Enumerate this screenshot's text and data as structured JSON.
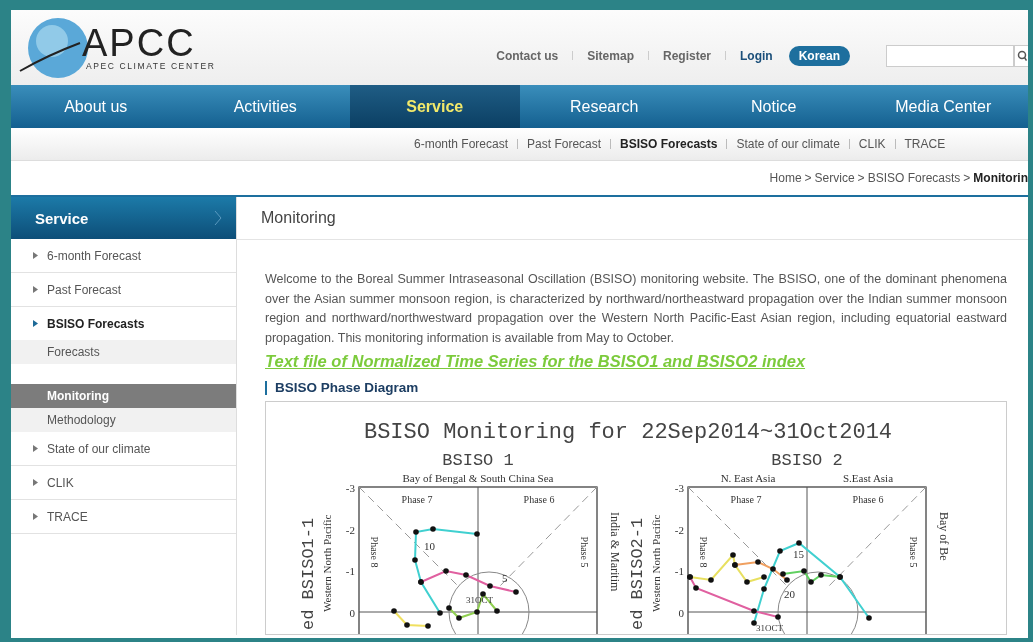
{
  "header": {
    "logo_text": "APCC",
    "logo_subtitle": "APEC CLIMATE CENTER",
    "top_links": [
      {
        "label": "Contact us",
        "kind": "plain"
      },
      {
        "label": "Sitemap",
        "kind": "plain"
      },
      {
        "label": "Register",
        "kind": "plain"
      },
      {
        "label": "Login",
        "kind": "strong"
      },
      {
        "label": "Korean",
        "kind": "pill"
      }
    ]
  },
  "nav": [
    {
      "label": "About us",
      "selected": false
    },
    {
      "label": "Activities",
      "selected": false
    },
    {
      "label": "Service",
      "selected": true
    },
    {
      "label": "Research",
      "selected": false
    },
    {
      "label": "Notice",
      "selected": false
    },
    {
      "label": "Media Center",
      "selected": false
    }
  ],
  "subnav": [
    {
      "label": "6-month Forecast",
      "selected": false
    },
    {
      "label": "Past Forecast",
      "selected": false
    },
    {
      "label": "BSISO Forecasts",
      "selected": true
    },
    {
      "label": "State of our climate",
      "selected": false
    },
    {
      "label": "CLIK",
      "selected": false
    },
    {
      "label": "TRACE",
      "selected": false
    }
  ],
  "breadcrumb": [
    "Home",
    "Service",
    "BSISO Forecasts",
    "Monitorin"
  ],
  "breadcrumb_separator": ">",
  "sidebar": {
    "title": "Service",
    "items": [
      {
        "label": "6-month Forecast",
        "selected": false,
        "expanded": false
      },
      {
        "label": "Past Forecast",
        "selected": false,
        "expanded": false
      },
      {
        "label": "BSISO Forecasts",
        "selected": true,
        "expanded": true,
        "children": [
          {
            "label": "Forecasts",
            "selected": false
          },
          {
            "label": "Monitoring",
            "selected": true
          },
          {
            "label": "Methodology",
            "selected": false
          }
        ]
      },
      {
        "label": "State of our climate",
        "selected": false,
        "expanded": false
      },
      {
        "label": "CLIK",
        "selected": false,
        "expanded": false
      },
      {
        "label": "TRACE",
        "selected": false,
        "expanded": false
      }
    ]
  },
  "main": {
    "heading": "Monitoring",
    "intro": "Welcome to the Boreal Summer Intraseasonal Oscillation (BSISO) monitoring website. The BSISO, one of the dominant phenomena over the Asian summer monsoon region, is characterized by northward/northeastward propagation over the Indian summer monsoon region and northward/northwestward propagation over the Western North Pacific-East Asian region, including equatorial eastward propagation. This monitoring information is available from May to October.",
    "download_link": "Text file of Normalized Time Series for the BSISO1 and BSISO2 index",
    "section_title": "BSISO Phase Diagram",
    "figure": {
      "title": "BSISO Monitoring for 22Sep2014~31Oct2014",
      "panels": [
        {
          "title": "BSISO 1",
          "top_labels": [
            "Bay of Bengal & South China Sea"
          ],
          "ylabel": "ed BSISO1-1",
          "left_label": "Western North Pacific",
          "right_label": "India & Maritim",
          "phase_labels": [
            "Phase 7",
            "Phase 6",
            "Phase 8",
            "Phase 5"
          ],
          "yticks": [
            "-3",
            "-2",
            "-1",
            "0"
          ],
          "point_labels": [
            "10",
            "5",
            "31OCT"
          ]
        },
        {
          "title": "BSISO 2",
          "top_labels": [
            "N. East Asia",
            "S.East Asia"
          ],
          "ylabel": "ed BSISO2-1",
          "left_label": "Western North Pacific",
          "right_label": "Bay of Be",
          "phase_labels": [
            "Phase 7",
            "Phase 6",
            "Phase 8",
            "Phase 5"
          ],
          "yticks": [
            "-3",
            "-2",
            "-1",
            "0"
          ],
          "point_labels": [
            "15",
            "20",
            "31OCT"
          ]
        }
      ]
    }
  }
}
